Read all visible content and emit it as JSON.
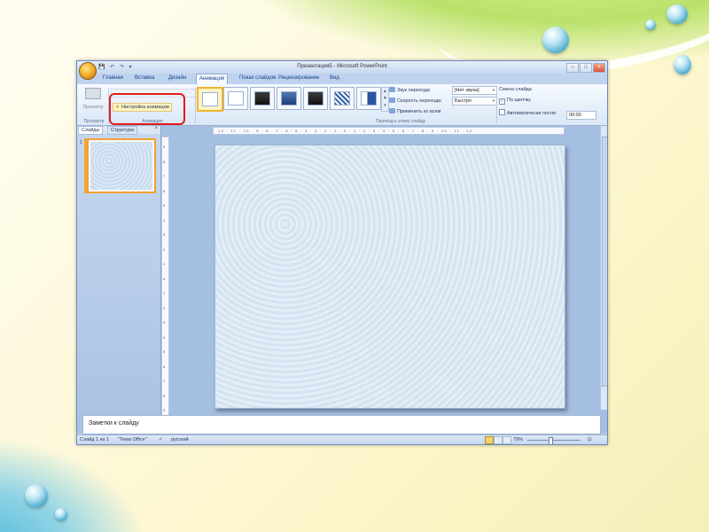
{
  "window": {
    "title": "Презентация5 - Microsoft PowerPoint",
    "controls": [
      "–",
      "□",
      "×"
    ]
  },
  "quick_access": {
    "icons": [
      "save-icon",
      "undo-icon",
      "redo-icon",
      "customize-icon"
    ],
    "text": "💾 ↶ ↷ ▾"
  },
  "tabs": [
    "Главная",
    "Вставка",
    "Дизайн",
    "Анимация",
    "Показ слайдов",
    "Рецензирование",
    "Вид"
  ],
  "active_tab": "Анимация",
  "ribbon": {
    "preview": {
      "button_label": "Просмотр",
      "group_label": "Просмотр"
    },
    "animation": {
      "custom_animation_label": "Настройка анимации",
      "group_label": "Анимация"
    },
    "transitions": {
      "group_label": "Переход к этому слайду",
      "sound_label": "Звук перехода:",
      "sound_value": "[Нет звука]",
      "speed_label": "Скорость перехода:",
      "speed_value": "Быстро",
      "apply_all_label": "Применить ко всем"
    },
    "advance": {
      "title": "Смена слайда",
      "on_click_label": "По щелчку",
      "on_click_checked": true,
      "auto_label": "Автоматически после:",
      "auto_checked": false,
      "auto_time": "00:00"
    }
  },
  "left_pane": {
    "tabs": [
      "Слайды",
      "Структура"
    ],
    "active_tab": "Слайды",
    "slide_number": "1"
  },
  "ruler": {
    "horizontal": "· 12 · 11 · 10 · 9 · 8 · 7 · 6 · 5 · 4 · 3 · 2 · 1 · 0 · 1 · 2 · 3 · 4 · 5 · 6 · 7 · 8 · 9 · 10 · 11 · 12 ·",
    "vertical": [
      "9",
      "8",
      "7",
      "6",
      "5",
      "4",
      "3",
      "2",
      "1",
      "0",
      "1",
      "2",
      "3",
      "4",
      "5",
      "6",
      "7",
      "8",
      "9"
    ]
  },
  "notes": {
    "placeholder": "Заметки к слайду"
  },
  "status_bar": {
    "slide_info": "Слайд 1 из 1",
    "theme": "\"Тема Office\"",
    "language": "русский",
    "zoom": "79%"
  },
  "colors": {
    "highlight": "#e21b1b",
    "ribbon_bg": "#dbe7f6",
    "accent_orange": "#f1a130"
  }
}
